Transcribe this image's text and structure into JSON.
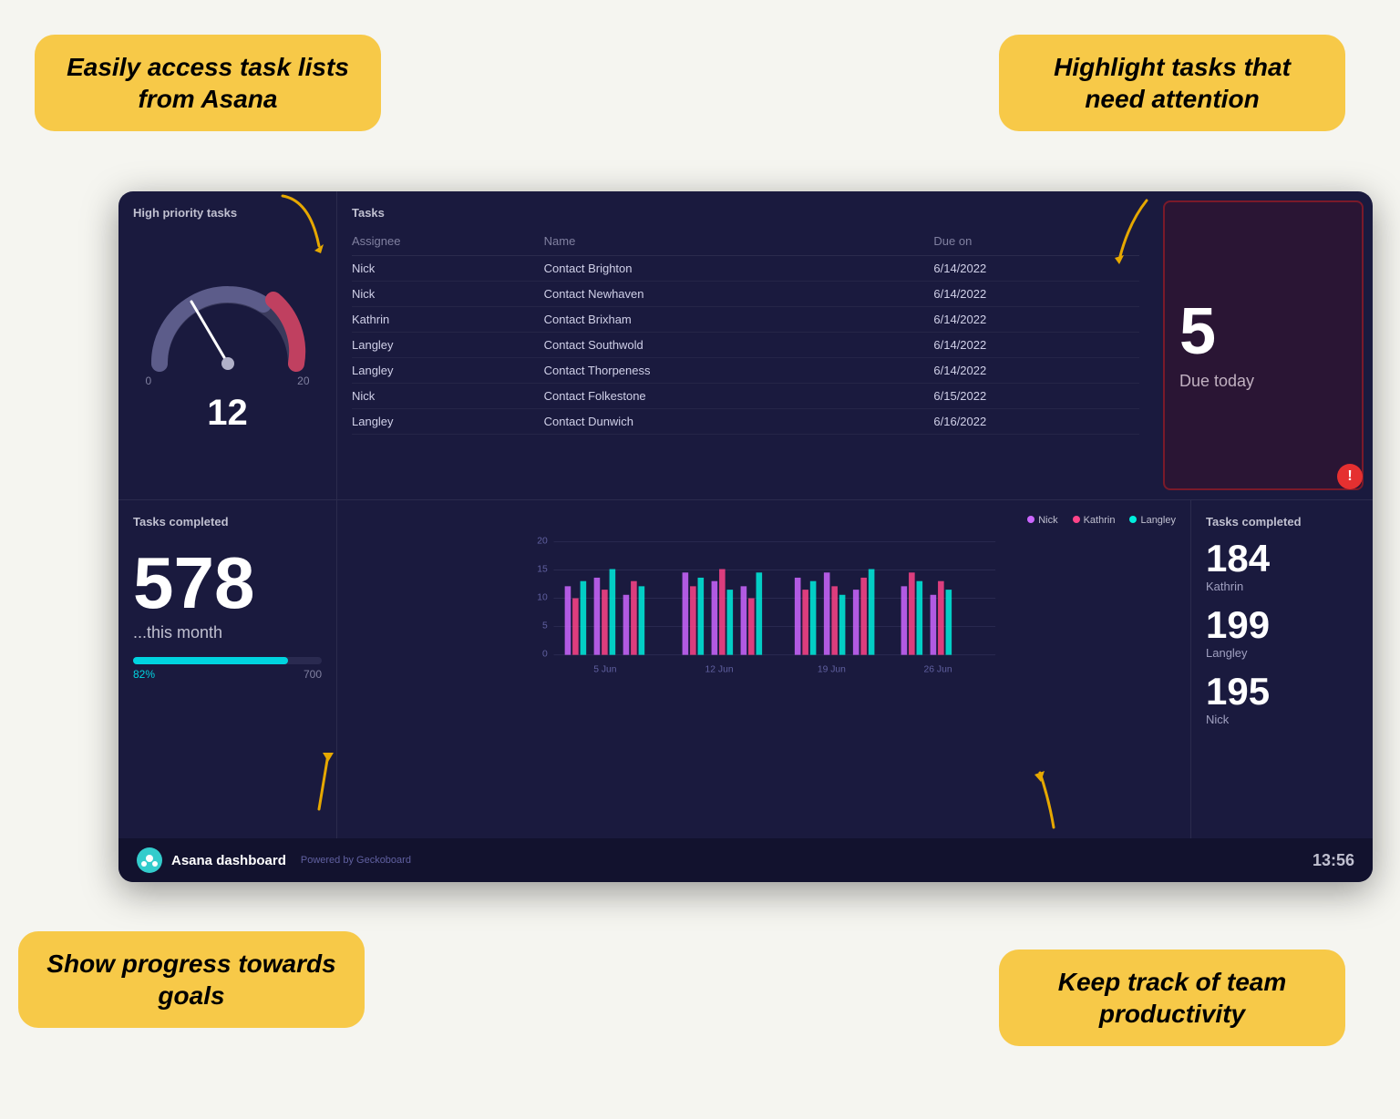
{
  "callouts": {
    "tl": {
      "text": "Easily access task lists from Asana"
    },
    "tr": {
      "text": "Highlight tasks that need attention"
    },
    "bl": {
      "text": "Show progress towards goals"
    },
    "br": {
      "text": "Keep track of team productivity"
    }
  },
  "dashboard": {
    "high_priority": {
      "title": "High priority tasks",
      "gauge_current": "12",
      "gauge_min": "0",
      "gauge_max": "20"
    },
    "tasks_panel": {
      "title": "Tasks",
      "columns": [
        "Assignee",
        "Name",
        "Due on"
      ],
      "rows": [
        {
          "assignee": "Nick",
          "name": "Contact Brighton",
          "due": "6/14/2022"
        },
        {
          "assignee": "Nick",
          "name": "Contact Newhaven",
          "due": "6/14/2022"
        },
        {
          "assignee": "Kathrin",
          "name": "Contact Brixham",
          "due": "6/14/2022"
        },
        {
          "assignee": "Langley",
          "name": "Contact Southwold",
          "due": "6/14/2022"
        },
        {
          "assignee": "Langley",
          "name": "Contact Thorpeness",
          "due": "6/14/2022"
        },
        {
          "assignee": "Nick",
          "name": "Contact Folkestone",
          "due": "6/15/2022"
        },
        {
          "assignee": "Langley",
          "name": "Contact Dunwich",
          "due": "6/16/2022"
        }
      ]
    },
    "due_today": {
      "number": "5",
      "label": "Due today"
    },
    "tasks_completed": {
      "title": "Tasks completed",
      "big_number": "578",
      "sub_label": "...this month",
      "progress_pct": "82%",
      "progress_target": "700",
      "progress_fill": 82
    },
    "chart": {
      "y_max": 20,
      "y_labels": [
        "20",
        "15",
        "10",
        "5",
        "0"
      ],
      "x_labels": [
        "5 Jun",
        "12 Jun",
        "19 Jun",
        "26 Jun"
      ],
      "legend": [
        {
          "name": "Nick",
          "color": "#cc66ff"
        },
        {
          "name": "Kathrin",
          "color": "#ff4488"
        },
        {
          "name": "Langley",
          "color": "#00eedd"
        }
      ]
    },
    "team_stats": {
      "title": "Tasks completed",
      "people": [
        {
          "name": "Kathrin",
          "number": "184"
        },
        {
          "name": "Langley",
          "number": "199"
        },
        {
          "name": "Nick",
          "number": "195"
        }
      ]
    },
    "footer": {
      "logo_text": "A",
      "title": "Asana dashboard",
      "powered": "Powered by Geckoboard",
      "time": "13:56"
    }
  }
}
